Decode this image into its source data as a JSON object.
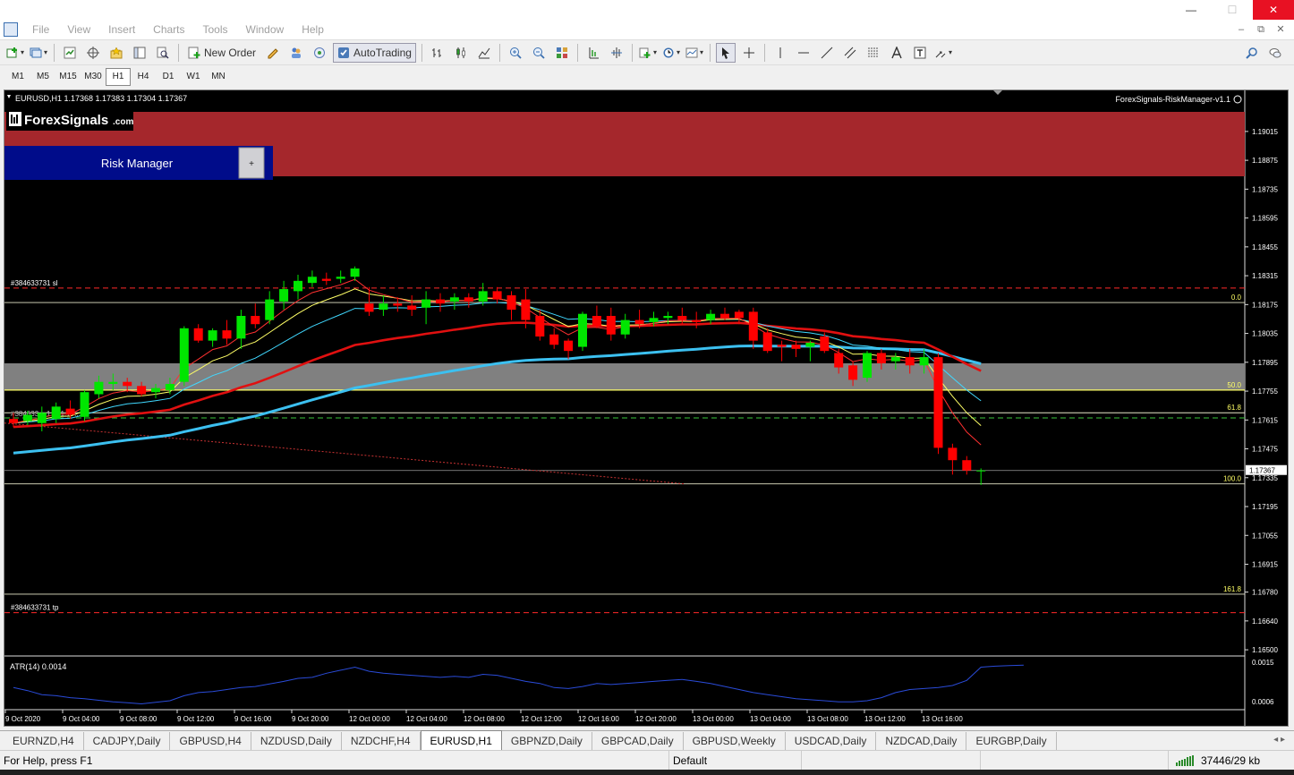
{
  "window": {
    "minimize": "—",
    "maximize": "☐",
    "close": "✕"
  },
  "menu": {
    "items": [
      "File",
      "View",
      "Insert",
      "Charts",
      "Tools",
      "Window",
      "Help"
    ],
    "child_controls": {
      "minimize": "–",
      "restore": "⧉",
      "close": "✕"
    }
  },
  "toolbar": {
    "new_order_label": "New Order",
    "autotrading_label": "AutoTrading"
  },
  "periods": {
    "items": [
      "M1",
      "M5",
      "M15",
      "M30",
      "H1",
      "H4",
      "D1",
      "W1",
      "MN"
    ],
    "active": "H1"
  },
  "chart": {
    "header": "EURUSD,H1  1.17368 1.17383 1.17304 1.17367",
    "ea_label": "ForexSignals-RiskManager-v1.1",
    "logo_text": "ForexSignals",
    "logo_suffix": ".com",
    "risk_manager_label": "Risk Manager",
    "risk_manager_toggle": "+",
    "sl_label": "#384633731 sl",
    "tp_label": "#384633731 tp",
    "entry_label": "#384633... 1 ... 1.17... ",
    "fib_labels": [
      "0.0",
      "50.0",
      "61.8",
      "100.0",
      "161.8"
    ],
    "current_price": "1.17367",
    "price_ticks": [
      "1.19015",
      "1.18875",
      "1.18735",
      "1.18595",
      "1.18455",
      "1.18315",
      "1.18175",
      "1.18035",
      "1.17895",
      "1.17755",
      "1.17615",
      "1.17475",
      "1.17335",
      "1.17195",
      "1.17055",
      "1.16915",
      "1.16780",
      "1.16640",
      "1.16500"
    ],
    "time_ticks": [
      "9 Oct 2020",
      "9 Oct 04:00",
      "9 Oct 08:00",
      "9 Oct 12:00",
      "9 Oct 16:00",
      "9 Oct 20:00",
      "12 Oct 00:00",
      "12 Oct 04:00",
      "12 Oct 08:00",
      "12 Oct 12:00",
      "12 Oct 16:00",
      "12 Oct 20:00",
      "13 Oct 00:00",
      "13 Oct 04:00",
      "13 Oct 08:00",
      "13 Oct 12:00",
      "13 Oct 16:00"
    ],
    "atr_label": "ATR(14) 0.0014",
    "atr_ticks": [
      "0.0015",
      "0.0006"
    ],
    "colors": {
      "bull": "#00e600",
      "bear": "#ff0000",
      "band": "#a5272c",
      "panel": "#000c8a",
      "zone": "#808080"
    }
  },
  "tabs": {
    "items": [
      "EURNZD,H4",
      "CADJPY,Daily",
      "GBPUSD,H4",
      "NZDUSD,Daily",
      "NZDCHF,H4",
      "EURUSD,H1",
      "GBPNZD,Daily",
      "GBPCAD,Daily",
      "GBPUSD,Weekly",
      "USDCAD,Daily",
      "NZDCAD,Daily",
      "EURGBP,Daily"
    ],
    "active": "EURUSD,H1",
    "arrows": "◂ ▸"
  },
  "status": {
    "help": "For Help, press F1",
    "profile": "Default",
    "traffic": "37446/29 kb"
  },
  "chart_data": {
    "type": "candlestick",
    "candles": [
      {
        "o": 1.1762,
        "h": 1.1765,
        "l": 1.1758,
        "c": 1.176
      },
      {
        "o": 1.1761,
        "h": 1.1766,
        "l": 1.1759,
        "c": 1.1764
      },
      {
        "o": 1.176,
        "h": 1.1768,
        "l": 1.1756,
        "c": 1.1765
      },
      {
        "o": 1.1762,
        "h": 1.177,
        "l": 1.176,
        "c": 1.1768
      },
      {
        "o": 1.1767,
        "h": 1.1771,
        "l": 1.1762,
        "c": 1.1764
      },
      {
        "o": 1.1763,
        "h": 1.1776,
        "l": 1.1761,
        "c": 1.1775
      },
      {
        "o": 1.1774,
        "h": 1.1783,
        "l": 1.1772,
        "c": 1.178
      },
      {
        "o": 1.1779,
        "h": 1.1784,
        "l": 1.1776,
        "c": 1.178
      },
      {
        "o": 1.178,
        "h": 1.1782,
        "l": 1.1775,
        "c": 1.1778
      },
      {
        "o": 1.1778,
        "h": 1.178,
        "l": 1.1773,
        "c": 1.1774
      },
      {
        "o": 1.1775,
        "h": 1.1779,
        "l": 1.1772,
        "c": 1.1777
      },
      {
        "o": 1.1776,
        "h": 1.1782,
        "l": 1.1774,
        "c": 1.1779
      },
      {
        "o": 1.178,
        "h": 1.1807,
        "l": 1.1778,
        "c": 1.1806
      },
      {
        "o": 1.1806,
        "h": 1.1808,
        "l": 1.1799,
        "c": 1.18
      },
      {
        "o": 1.18,
        "h": 1.1806,
        "l": 1.1797,
        "c": 1.1805
      },
      {
        "o": 1.1805,
        "h": 1.181,
        "l": 1.1798,
        "c": 1.1801
      },
      {
        "o": 1.1801,
        "h": 1.1815,
        "l": 1.1796,
        "c": 1.1812
      },
      {
        "o": 1.1812,
        "h": 1.1818,
        "l": 1.1806,
        "c": 1.1808
      },
      {
        "o": 1.181,
        "h": 1.1824,
        "l": 1.1808,
        "c": 1.182
      },
      {
        "o": 1.1819,
        "h": 1.1829,
        "l": 1.1815,
        "c": 1.1825
      },
      {
        "o": 1.1824,
        "h": 1.1832,
        "l": 1.182,
        "c": 1.1829
      },
      {
        "o": 1.1828,
        "h": 1.1834,
        "l": 1.1826,
        "c": 1.1831
      },
      {
        "o": 1.183,
        "h": 1.1833,
        "l": 1.1827,
        "c": 1.1829
      },
      {
        "o": 1.183,
        "h": 1.1834,
        "l": 1.1828,
        "c": 1.1831
      },
      {
        "o": 1.1831,
        "h": 1.1836,
        "l": 1.1829,
        "c": 1.1835
      },
      {
        "o": 1.1818,
        "h": 1.1826,
        "l": 1.1812,
        "c": 1.1814
      },
      {
        "o": 1.1815,
        "h": 1.1822,
        "l": 1.1812,
        "c": 1.1818
      },
      {
        "o": 1.1818,
        "h": 1.1821,
        "l": 1.1814,
        "c": 1.1817
      },
      {
        "o": 1.1817,
        "h": 1.1822,
        "l": 1.1812,
        "c": 1.1815
      },
      {
        "o": 1.1816,
        "h": 1.1824,
        "l": 1.1808,
        "c": 1.182
      },
      {
        "o": 1.182,
        "h": 1.1823,
        "l": 1.1814,
        "c": 1.1818
      },
      {
        "o": 1.1819,
        "h": 1.1823,
        "l": 1.1815,
        "c": 1.1821
      },
      {
        "o": 1.1821,
        "h": 1.1823,
        "l": 1.1816,
        "c": 1.1819
      },
      {
        "o": 1.1819,
        "h": 1.1828,
        "l": 1.1817,
        "c": 1.1824
      },
      {
        "o": 1.1824,
        "h": 1.1826,
        "l": 1.1818,
        "c": 1.182
      },
      {
        "o": 1.1822,
        "h": 1.1824,
        "l": 1.181,
        "c": 1.1815
      },
      {
        "o": 1.182,
        "h": 1.1825,
        "l": 1.1806,
        "c": 1.181
      },
      {
        "o": 1.1812,
        "h": 1.1815,
        "l": 1.18,
        "c": 1.1802
      },
      {
        "o": 1.1803,
        "h": 1.1806,
        "l": 1.1796,
        "c": 1.1798
      },
      {
        "o": 1.18,
        "h": 1.1801,
        "l": 1.1791,
        "c": 1.1795
      },
      {
        "o": 1.1797,
        "h": 1.1814,
        "l": 1.1795,
        "c": 1.1813
      },
      {
        "o": 1.1812,
        "h": 1.1817,
        "l": 1.1806,
        "c": 1.1807
      },
      {
        "o": 1.1812,
        "h": 1.1816,
        "l": 1.18,
        "c": 1.1803
      },
      {
        "o": 1.1803,
        "h": 1.1813,
        "l": 1.1801,
        "c": 1.181
      },
      {
        "o": 1.181,
        "h": 1.1815,
        "l": 1.1806,
        "c": 1.1808
      },
      {
        "o": 1.1809,
        "h": 1.1814,
        "l": 1.1807,
        "c": 1.1811
      },
      {
        "o": 1.1811,
        "h": 1.1814,
        "l": 1.1808,
        "c": 1.1812
      },
      {
        "o": 1.1812,
        "h": 1.1816,
        "l": 1.1808,
        "c": 1.181
      },
      {
        "o": 1.181,
        "h": 1.1814,
        "l": 1.1806,
        "c": 1.1809
      },
      {
        "o": 1.181,
        "h": 1.1815,
        "l": 1.1808,
        "c": 1.1813
      },
      {
        "o": 1.1813,
        "h": 1.1816,
        "l": 1.181,
        "c": 1.1811
      },
      {
        "o": 1.1814,
        "h": 1.1815,
        "l": 1.1808,
        "c": 1.1811
      },
      {
        "o": 1.1814,
        "h": 1.1816,
        "l": 1.1796,
        "c": 1.18
      },
      {
        "o": 1.1804,
        "h": 1.1806,
        "l": 1.1794,
        "c": 1.1795
      },
      {
        "o": 1.1798,
        "h": 1.18,
        "l": 1.179,
        "c": 1.1797
      },
      {
        "o": 1.1798,
        "h": 1.18,
        "l": 1.1792,
        "c": 1.1796
      },
      {
        "o": 1.1797,
        "h": 1.18,
        "l": 1.179,
        "c": 1.1799
      },
      {
        "o": 1.1802,
        "h": 1.1804,
        "l": 1.1794,
        "c": 1.1795
      },
      {
        "o": 1.1794,
        "h": 1.1796,
        "l": 1.1784,
        "c": 1.1787
      },
      {
        "o": 1.1788,
        "h": 1.179,
        "l": 1.1778,
        "c": 1.1781
      },
      {
        "o": 1.1782,
        "h": 1.1795,
        "l": 1.178,
        "c": 1.1794
      },
      {
        "o": 1.1794,
        "h": 1.1796,
        "l": 1.1786,
        "c": 1.1789
      },
      {
        "o": 1.179,
        "h": 1.1794,
        "l": 1.1786,
        "c": 1.1792
      },
      {
        "o": 1.1792,
        "h": 1.1796,
        "l": 1.1784,
        "c": 1.1788
      },
      {
        "o": 1.1788,
        "h": 1.1796,
        "l": 1.1784,
        "c": 1.1792
      },
      {
        "o": 1.1792,
        "h": 1.1794,
        "l": 1.1745,
        "c": 1.1748
      },
      {
        "o": 1.1748,
        "h": 1.175,
        "l": 1.1735,
        "c": 1.1742
      },
      {
        "o": 1.1742,
        "h": 1.1744,
        "l": 1.1735,
        "c": 1.1737
      },
      {
        "o": 1.1737,
        "h": 1.1738,
        "l": 1.173,
        "c": 1.1737
      }
    ],
    "price_range": [
      1.1647,
      1.1911
    ],
    "fib_levels": {
      "0.0": 1.18185,
      "50.0": 1.1776,
      "61.8": 1.1765,
      "100.0": 1.17305,
      "161.8": 1.1677
    },
    "sl_price": 1.18255,
    "tp_price": 1.1668,
    "entry_price": 1.17625,
    "zone": [
      1.1776,
      1.1789
    ],
    "atr": [
      0.001,
      0.00094,
      0.00086,
      0.00084,
      0.0008,
      0.00078,
      0.00075,
      0.00072,
      0.0007,
      0.00068,
      0.00071,
      0.00074,
      0.00084,
      0.0009,
      0.00092,
      0.00096,
      0.001,
      0.00102,
      0.00107,
      0.00112,
      0.00118,
      0.0012,
      0.00128,
      0.00134,
      0.0014,
      0.00132,
      0.00128,
      0.00126,
      0.00124,
      0.00122,
      0.0012,
      0.00122,
      0.0012,
      0.00126,
      0.00124,
      0.00118,
      0.00112,
      0.00108,
      0.001,
      0.00098,
      0.00102,
      0.00108,
      0.00106,
      0.00108,
      0.0011,
      0.00112,
      0.00114,
      0.00116,
      0.00112,
      0.00108,
      0.00102,
      0.00096,
      0.0009,
      0.00086,
      0.00082,
      0.00078,
      0.00076,
      0.00074,
      0.00072,
      0.00072,
      0.00074,
      0.0008,
      0.0009,
      0.00096,
      0.00098,
      0.001,
      0.00104,
      0.00114,
      0.0014,
      0.00142,
      0.00143,
      0.00144
    ]
  }
}
